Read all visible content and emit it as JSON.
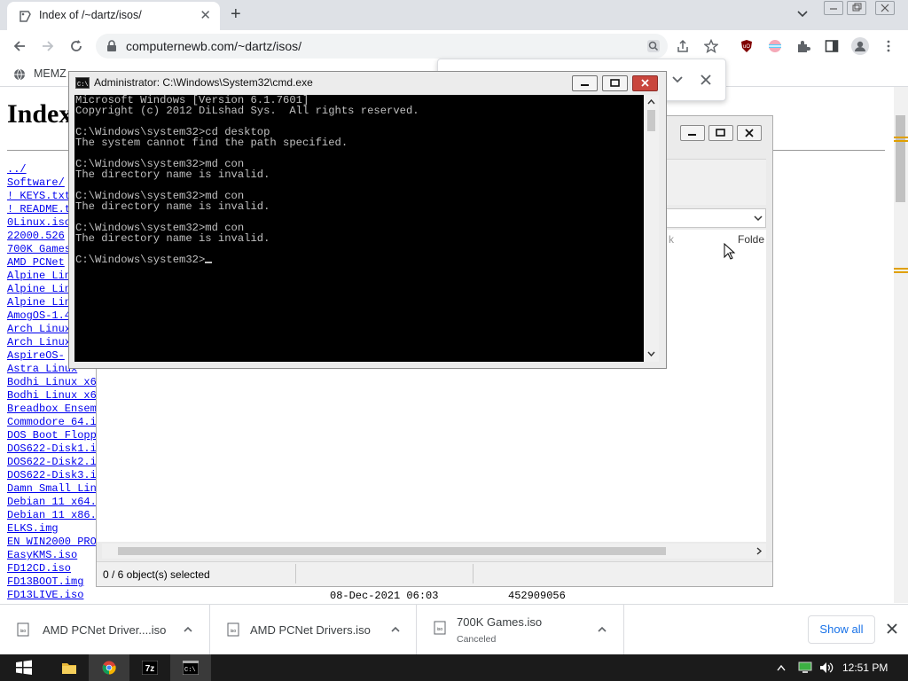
{
  "browser": {
    "tab_title": "Index of /~dartz/isos/",
    "url": "computernewb.com/~dartz/isos/",
    "bookmark": "MEMZ"
  },
  "page": {
    "heading": "Index",
    "files": [
      "../",
      "Software/",
      "! KEYS.txt",
      "! README.t",
      "0Linux.iso",
      "22000.526",
      "700K Games",
      "AMD PCNet",
      "Alpine Lin",
      "Alpine Lin",
      "Alpine Lin",
      "AmogOS-1.4",
      "Arch Linux",
      "Arch Linux",
      "AspireOS-",
      "Astra Linux",
      "Bodhi Linux x6",
      "Bodhi Linux x6",
      "Breadbox Ensem",
      "Commodore 64.i",
      "DOS Boot Flopp",
      "DOS622-Disk1.i",
      "DOS622-Disk2.i",
      "DOS622-Disk3.i",
      "Damn Small Lin",
      "Debian 11 x64.",
      "Debian 11 x86.",
      "ELKS.img",
      "EN WIN2000 PRO",
      "EasyKMS.iso",
      "FD12CD.iso",
      "FD13BOOT.img",
      "FD13LIVE.iso"
    ],
    "last_row_date": "08-Dec-2021 06:03",
    "last_row_size": "452909056"
  },
  "explorer": {
    "column_folder": "Folde",
    "status": "0 / 6 object(s) selected"
  },
  "cmd": {
    "title": "Administrator: C:\\Windows\\System32\\cmd.exe",
    "lines": [
      "Microsoft Windows [Version 6.1.7601]",
      "Copyright (c) 2012 DiLshad Sys.  All rights reserved.",
      "",
      "C:\\Windows\\system32>cd desktop",
      "The system cannot find the path specified.",
      "",
      "C:\\Windows\\system32>md con",
      "The directory name is invalid.",
      "",
      "C:\\Windows\\system32>md con",
      "The directory name is invalid.",
      "",
      "C:\\Windows\\system32>md con",
      "The directory name is invalid.",
      "",
      "C:\\Windows\\system32>"
    ]
  },
  "downloads": {
    "items": [
      {
        "name": "AMD PCNet Driver....iso",
        "status": ""
      },
      {
        "name": "AMD PCNet Drivers.iso",
        "status": ""
      },
      {
        "name": "700K Games.iso",
        "status": "Canceled"
      }
    ],
    "show_all": "Show all"
  },
  "taskbar": {
    "time": "12:51 PM",
    "apps": [
      "start-icon",
      "file-explorer-icon",
      "chrome-icon",
      "7zip-icon",
      "cmd-icon"
    ]
  },
  "colors": {
    "link": "#0000ee",
    "accent_blue": "#1a73e8",
    "taskbar": "#1b1b1b",
    "console_bg": "#000000",
    "console_text": "#c0c0c0"
  }
}
